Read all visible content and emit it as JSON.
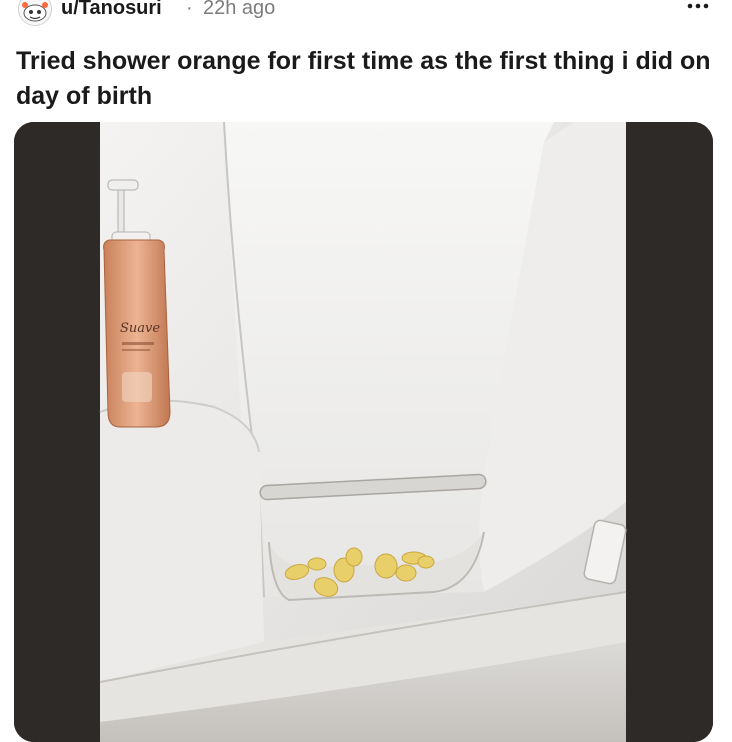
{
  "post": {
    "username": "u/Tanosuri",
    "separator": "·",
    "time_ago": "22h ago",
    "more_icon": "more-horizontal-icon",
    "title": "Tried shower orange for first time as the first thing i did on day of birth"
  },
  "media": {
    "bottle_brand": "Suave"
  },
  "colors": {
    "text_primary": "#1a1a1b",
    "text_secondary": "#7c7c7c",
    "media_letterbox": "#2b2826",
    "peel": "#e9cf6a"
  }
}
